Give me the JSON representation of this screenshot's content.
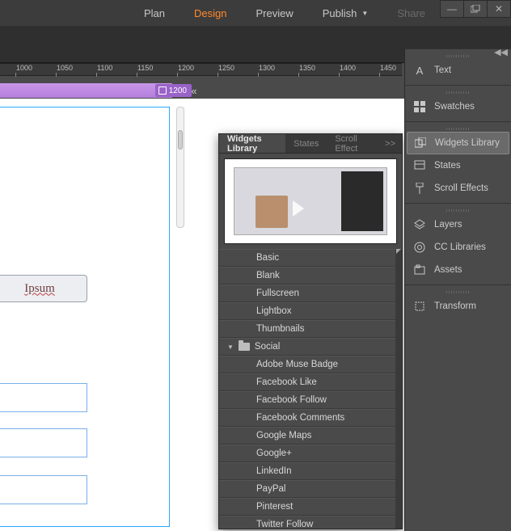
{
  "menu": {
    "plan": "Plan",
    "design": "Design",
    "preview": "Preview",
    "publish": "Publish",
    "share": "Share"
  },
  "ruler": {
    "ticks": [
      "1000",
      "1050",
      "1100",
      "1150",
      "1200",
      "1250",
      "1300",
      "1350",
      "1400",
      "1450"
    ],
    "guide_value": "1200"
  },
  "canvas": {
    "lorem": "Ipsum"
  },
  "widgets_panel": {
    "tabs": {
      "library": "Widgets Library",
      "states": "States",
      "scroll": "Scroll Effect"
    },
    "items": {
      "basic": "Basic",
      "blank": "Blank",
      "fullscreen": "Fullscreen",
      "lightbox": "Lightbox",
      "thumbnails": "Thumbnails",
      "social_folder": "Social",
      "adobe_muse_badge": "Adobe Muse Badge",
      "facebook_like": "Facebook Like",
      "facebook_follow": "Facebook Follow",
      "facebook_comments": "Facebook Comments",
      "google_maps": "Google Maps",
      "google_plus": "Google+",
      "linkedin": "LinkedIn",
      "paypal": "PayPal",
      "pinterest": "Pinterest",
      "twitter_follow": "Twitter Follow"
    }
  },
  "dock": {
    "text": "Text",
    "swatches": "Swatches",
    "widgets_library": "Widgets Library",
    "states": "States",
    "scroll_effects": "Scroll Effects",
    "layers": "Layers",
    "cc_libraries": "CC Libraries",
    "assets": "Assets",
    "transform": "Transform"
  }
}
